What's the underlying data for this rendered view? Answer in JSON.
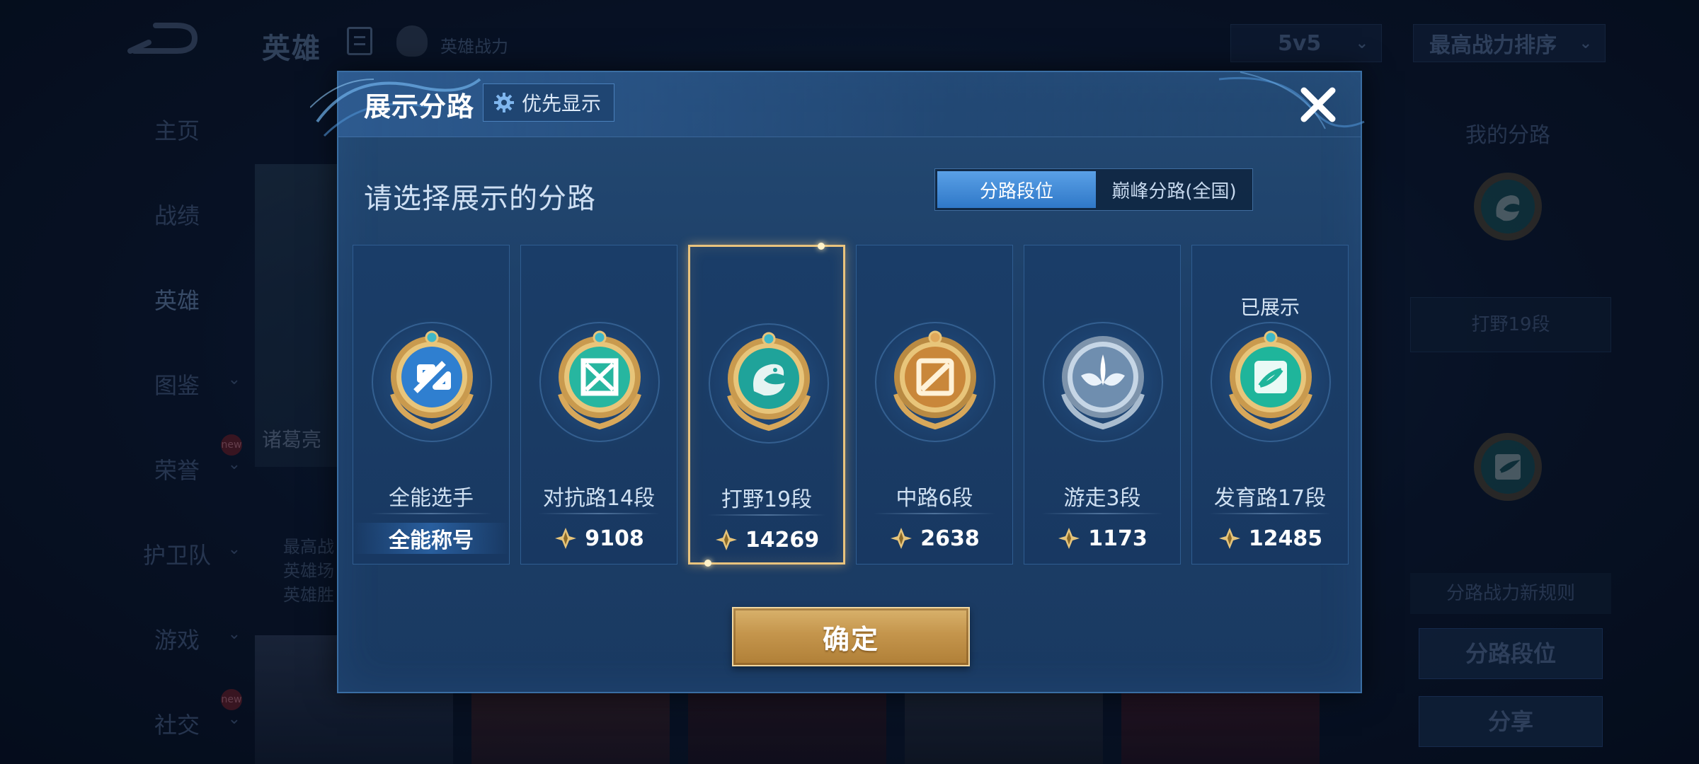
{
  "background": {
    "header": {
      "title": "英雄",
      "power_label": "英雄战力",
      "mode_select": "5v5",
      "sort_select": "最高战力排序"
    },
    "nav": [
      {
        "label": "主页",
        "has_chevron": false,
        "is_new": false
      },
      {
        "label": "战绩",
        "has_chevron": false,
        "is_new": false
      },
      {
        "label": "英雄",
        "has_chevron": false,
        "is_new": false,
        "active": true
      },
      {
        "label": "图鉴",
        "has_chevron": true,
        "is_new": false
      },
      {
        "label": "荣誉",
        "has_chevron": true,
        "is_new": true
      },
      {
        "label": "护卫队",
        "has_chevron": true,
        "is_new": false
      },
      {
        "label": "游戏",
        "has_chevron": true,
        "is_new": false
      },
      {
        "label": "社交",
        "has_chevron": true,
        "is_new": true
      }
    ],
    "new_badge": "new",
    "hero_card": {
      "name": "诸葛亮",
      "lines": [
        "最高战",
        "英雄场",
        "英雄胜"
      ]
    },
    "right_panel": {
      "title": "我的分路",
      "lane_box": "打野19段",
      "note": "分路战力新规则",
      "btn_lane": "分路段位",
      "btn_share": "分享"
    }
  },
  "dialog": {
    "title": "展示分路",
    "priority_label": "优先显示",
    "prompt": "请选择展示的分路",
    "tabs": [
      {
        "label": "分路段位",
        "active": true
      },
      {
        "label": "巅峰分路(全国)",
        "active": false
      }
    ],
    "lanes": [
      {
        "name": "全能选手",
        "value": "全能称号",
        "has_score_icon": false,
        "selected": false,
        "shown": false,
        "badge": "allround-badge-icon",
        "badge_color": "#2f7fd0"
      },
      {
        "name": "对抗路14段",
        "value": "9108",
        "has_score_icon": true,
        "selected": false,
        "shown": false,
        "badge": "clash-lane-badge-icon",
        "badge_color": "#27b6a0"
      },
      {
        "name": "打野19段",
        "value": "14269",
        "has_score_icon": true,
        "selected": true,
        "shown": false,
        "badge": "jungle-badge-icon",
        "badge_color": "#1fa39a"
      },
      {
        "name": "中路6段",
        "value": "2638",
        "has_score_icon": true,
        "selected": false,
        "shown": false,
        "badge": "mid-lane-badge-icon",
        "badge_color": "#c9873a"
      },
      {
        "name": "游走3段",
        "value": "1173",
        "has_score_icon": true,
        "selected": false,
        "shown": false,
        "badge": "roam-badge-icon",
        "badge_color": "#8aa6c2"
      },
      {
        "name": "发育路17段",
        "value": "12485",
        "has_score_icon": true,
        "selected": false,
        "shown": true,
        "badge": "farm-lane-badge-icon",
        "badge_color": "#1fb59b"
      }
    ],
    "shown_label": "已展示",
    "confirm_label": "确定"
  },
  "colors": {
    "accent_gold": "#e9c37d",
    "tab_active": "#2f78c8",
    "dialog_bg": "#1d3f68"
  }
}
